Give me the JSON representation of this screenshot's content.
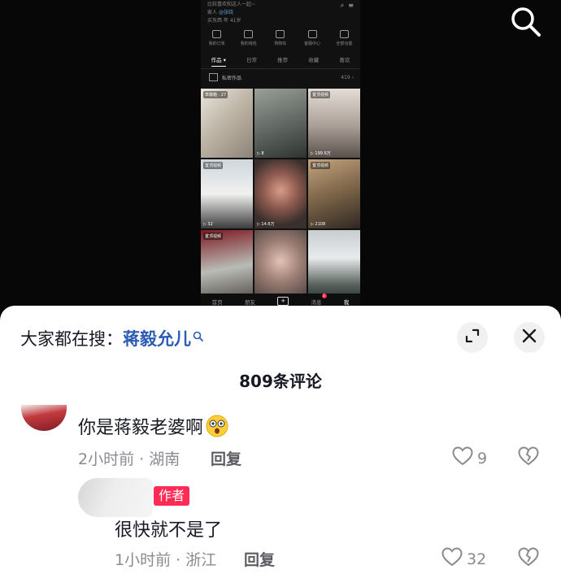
{
  "phone_preview": {
    "bio_line": "比较喜欢和这人一起~",
    "family_label": "家人",
    "family_name": "@张晓",
    "meta_line": "买东西   年 41岁",
    "tools": [
      "我的订单",
      "我的钱包",
      "购物车",
      "客服中心",
      "全部功能"
    ],
    "tabs": [
      "作品 ▾",
      "日常",
      "推荐",
      "收藏",
      "喜欢"
    ],
    "active_tab_index": 0,
    "draft_label": "私密作品",
    "works_count": "419",
    "grid": [
      {
        "tag": "草稿箱 · 27",
        "plays": ""
      },
      {
        "tag": "",
        "plays": "▷ 8"
      },
      {
        "tag": "置顶视频",
        "plays": "▷ 199.6万"
      },
      {
        "tag": "置顶视频",
        "plays": "▷ 32"
      },
      {
        "tag": "",
        "plays": "▷ 14.6万"
      },
      {
        "tag": "置顶视频",
        "plays": "▷ 2108"
      },
      {
        "tag": "置顶视频",
        "plays": ""
      },
      {
        "tag": "",
        "plays": ""
      },
      {
        "tag": "",
        "plays": ""
      }
    ],
    "nav": [
      "首页",
      "朋友",
      "+",
      "消息",
      "我"
    ],
    "msg_badge": "2"
  },
  "sheet": {
    "search_prefix": "大家都在搜：",
    "search_keyword": "蒋毅允儿",
    "comment_count_title": "809条评论"
  },
  "comments": [
    {
      "text": "你是蒋毅老婆啊",
      "meta": "2小时前 · 湖南",
      "reply_label": "回复",
      "likes": "9"
    },
    {
      "author_badge": "作者",
      "text": "很快就不是了",
      "meta": "1小时前 · 浙江",
      "reply_label": "回复",
      "likes": "32"
    }
  ],
  "colors": {
    "accent": "#fe2c55",
    "keyword": "#2b5bb3",
    "muted": "#8a8b91"
  },
  "icons": [
    "search-icon",
    "expand-icon",
    "close-icon",
    "heart-icon",
    "broken-heart-icon",
    "dizzy-face-emoji"
  ]
}
